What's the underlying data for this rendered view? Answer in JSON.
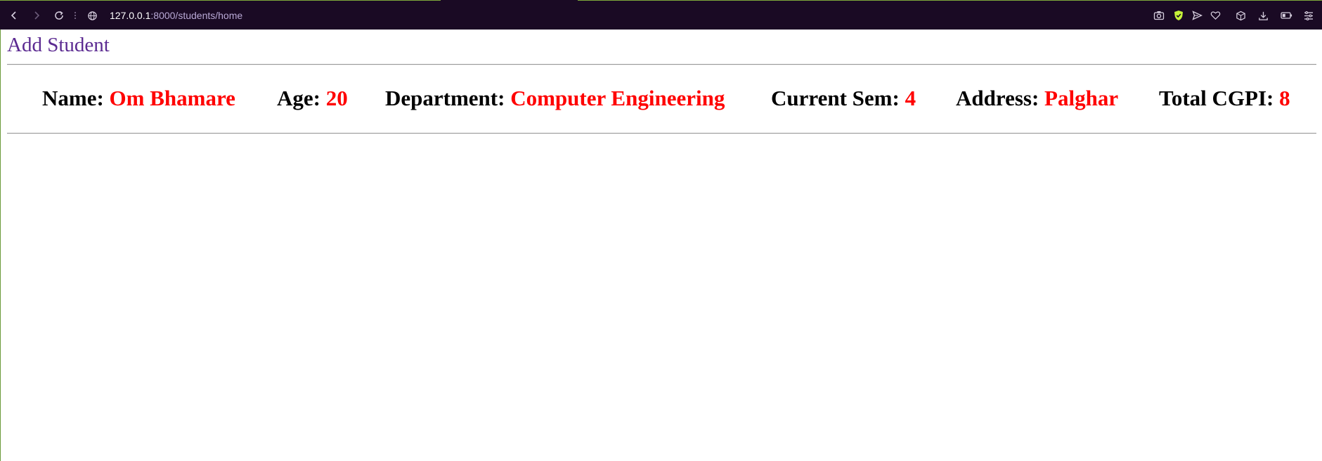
{
  "browser": {
    "url_host": "127.0.0.1",
    "url_path": ":8000/students/home",
    "icons": {
      "back": "back-arrow-icon",
      "forward": "forward-arrow-icon",
      "reload": "reload-icon",
      "site_info": "globe-icon",
      "screenshot": "camera-icon",
      "shield": "shield-icon",
      "send": "send-icon",
      "favorite": "heart-icon",
      "extensions": "cube-icon",
      "downloads": "download-icon",
      "battery": "battery-icon",
      "menu": "menu-icon"
    },
    "colors": {
      "toolbar_bg": "#1a0a24",
      "accent_border": "#7ea83b",
      "shield_green": "#c6f23a"
    }
  },
  "page": {
    "add_student_link": "Add Student",
    "link_color": "#5b2a91",
    "value_color": "#ff0000"
  },
  "student": {
    "name_label": "Name:",
    "name": "Om Bhamare",
    "age_label": "Age:",
    "age": "20",
    "department_label": "Department:",
    "department": "Computer Engineering",
    "sem_label": "Current Sem:",
    "sem": "4",
    "address_label": "Address:",
    "address": "Palghar",
    "cgpi_label": "Total CGPI:",
    "cgpi": "8"
  }
}
